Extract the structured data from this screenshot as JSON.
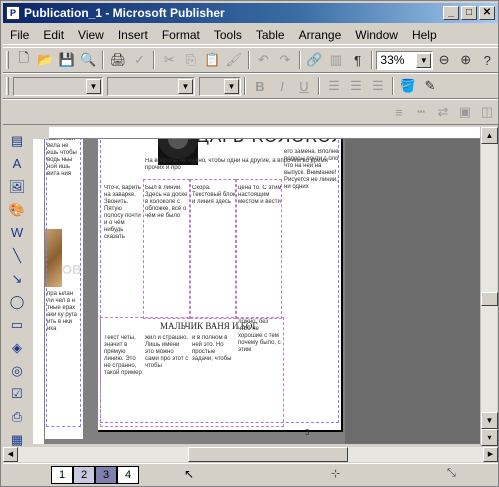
{
  "window": {
    "title": "Publication_1 - Microsoft Publisher",
    "app_icon": "publisher-icon",
    "controls": {
      "minimize": "_",
      "maximize": "□",
      "close": "✕"
    }
  },
  "menubar": {
    "items": [
      {
        "key": "file",
        "label": "File"
      },
      {
        "key": "edit",
        "label": "Edit"
      },
      {
        "key": "view",
        "label": "View"
      },
      {
        "key": "insert",
        "label": "Insert"
      },
      {
        "key": "format",
        "label": "Format"
      },
      {
        "key": "tools",
        "label": "Tools"
      },
      {
        "key": "table",
        "label": "Table"
      },
      {
        "key": "arrange",
        "label": "Arrange"
      },
      {
        "key": "window",
        "label": "Window"
      },
      {
        "key": "help",
        "label": "Help"
      }
    ]
  },
  "standard_toolbar": {
    "zoom": "33%"
  },
  "formatting_toolbar": {
    "style": "",
    "font": "",
    "size": ""
  },
  "document": {
    "headline": "ЦАРЬ-КОЛОКОЛ",
    "subheadline": "МАЛЬЧИК ВАНЯ И БОГ",
    "left_photo_caption": "ОВ",
    "page_number": "3"
  },
  "statusbar": {
    "page_tabs": [
      "1",
      "2",
      "3",
      "4"
    ],
    "current_page": "3"
  },
  "colors": {
    "title_start": "#0a246a",
    "title_end": "#a6caf0",
    "chrome": "#d4d0c8",
    "workspace": "#808080"
  }
}
